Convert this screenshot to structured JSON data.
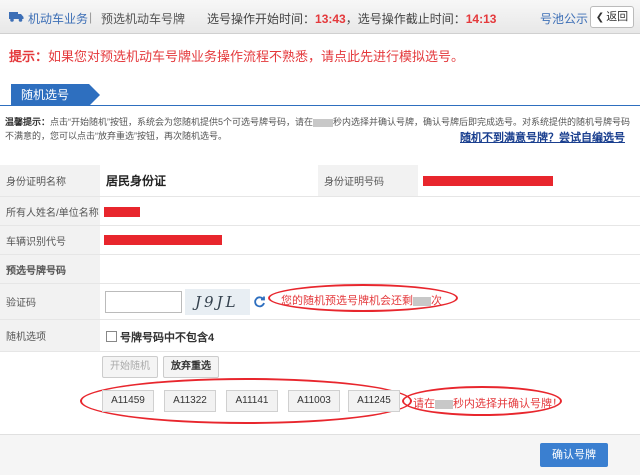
{
  "header": {
    "breadcrumb_main": "机动车业务",
    "breadcrumb_sep": "|",
    "breadcrumb_sub": "预选机动车号牌",
    "start_label": "选号操作开始时间：",
    "start_time": "13:43",
    "end_label": "，选号操作截止时间：",
    "end_time": "14:13",
    "pool_link": "号池公示",
    "back_label": "返回"
  },
  "hint": {
    "prefix": "提示：",
    "text": "如果您对预选机动车号牌业务操作流程不熟悉，请点此先进行模拟选号。"
  },
  "tab": {
    "label": "随机选号"
  },
  "notice": {
    "lead": "温馨提示：",
    "part1": "点击“开始随机”按钮，系统会为您随机提供5个可选号牌号码，请在",
    "part2": "秒内选择并确认号牌，确认号牌后即完成选号。对系统提供的随机号牌号码不满意的，您可以点击“放弃重选”按钮，再次随机选号。",
    "auto_link": "随机不到满意号牌？尝试自编选号"
  },
  "form": {
    "id_type_label": "身份证明名称",
    "id_type_value": "居民身份证",
    "id_number_label": "身份证明号码",
    "owner_label": "所有人姓名/单位名称",
    "vin_label": "车辆识别代号",
    "plate_label": "预选号牌号码",
    "captcha_label": "验证码",
    "captcha_image_text": "J9JL",
    "captcha_msg_prefix": "您的随机预选号牌机会还剩",
    "captcha_msg_suffix": "次",
    "options_label": "随机选项",
    "option_no4": "号牌号码中不包含4"
  },
  "buttons": {
    "start": "开始随机",
    "reset": "放弃重选",
    "confirm": "确认号牌"
  },
  "plates": [
    "A11459",
    "A11322",
    "A11141",
    "A11003",
    "A11245"
  ],
  "plate_msg": {
    "prefix": "请在",
    "suffix": "秒内选择并确认号牌！"
  },
  "colors": {
    "accent": "#2e6fbf",
    "alert": "#e4393c",
    "redaction": "#e8262d"
  }
}
